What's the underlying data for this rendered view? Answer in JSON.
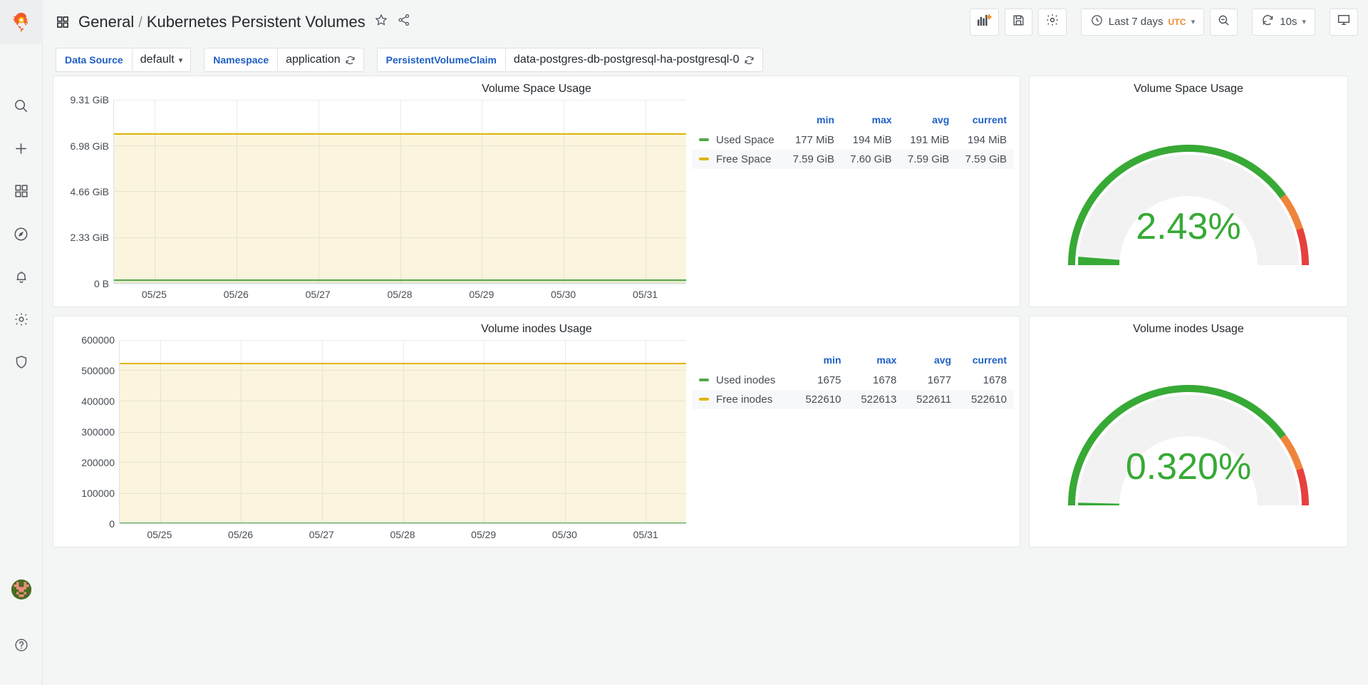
{
  "brand": {
    "logo_icon": "grafana-logo-icon"
  },
  "sidebar": {
    "items": [
      {
        "name": "search",
        "icon": "search-icon"
      },
      {
        "name": "create",
        "icon": "plus-icon"
      },
      {
        "name": "dashboards",
        "icon": "dashboards-grid-icon"
      },
      {
        "name": "explore",
        "icon": "compass-icon"
      },
      {
        "name": "alerting",
        "icon": "bell-icon"
      },
      {
        "name": "configuration",
        "icon": "gear-icon"
      },
      {
        "name": "server-admin",
        "icon": "shield-icon"
      }
    ],
    "bottom": [
      {
        "name": "user-profile",
        "icon": "avatar"
      },
      {
        "name": "help",
        "icon": "question-circle-icon"
      }
    ]
  },
  "topnav": {
    "folder": "General",
    "separator": "/",
    "dashboard_title": "Kubernetes Persistent Volumes",
    "star_icon": "star-icon",
    "share_icon": "share-nodes-icon",
    "dashboard_icon": "dashboard-grid-icon",
    "actions": {
      "add_panel_icon": "add-panel-icon",
      "save_icon": "save-disk-icon",
      "settings_icon": "gear-icon",
      "time_range": "Last 7 days",
      "time_zone": "UTC",
      "time_picker_icon": "clock-icon",
      "zoom_out_icon": "zoom-out-icon",
      "refresh_icon": "refresh-icon",
      "refresh_interval": "10s",
      "tv_icon": "tv-monitor-icon",
      "caret_icon": "chevron-down-icon"
    }
  },
  "variables": [
    {
      "label": "Data Source",
      "value": "default",
      "control": "dropdown",
      "trailing_icon": "chevron-down-icon"
    },
    {
      "label": "Namespace",
      "value": "application",
      "control": "select",
      "trailing_icon": "loading-spinner-icon"
    },
    {
      "label": "PersistentVolumeClaim",
      "value": "data-postgres-db-postgresql-ha-postgresql-0",
      "control": "select",
      "trailing_icon": "loading-spinner-icon"
    }
  ],
  "colors": {
    "green": "#56a64b",
    "yellow": "#e0b400",
    "gauge_green": "#37a935",
    "gauge_orange": "#ef843c",
    "gauge_red": "#e5413f",
    "gauge_track": "#f2f2f2",
    "link_blue": "#1f60c4",
    "accent_orange": "#ed8b2b"
  },
  "panels": [
    {
      "id": "volume-space-usage-graph",
      "title": "Volume Space Usage",
      "type": "graph"
    },
    {
      "id": "volume-space-usage-gauge",
      "title": "Volume Space Usage",
      "type": "gauge",
      "value": "2.43%",
      "value_pct": 2.43,
      "thresholds": [
        {
          "color": "#37a935",
          "from": 0
        },
        {
          "color": "#ef843c",
          "from": 80
        },
        {
          "color": "#e5413f",
          "from": 90
        }
      ]
    },
    {
      "id": "volume-inodes-usage-graph",
      "title": "Volume inodes Usage",
      "type": "graph"
    },
    {
      "id": "volume-inodes-usage-gauge",
      "title": "Volume inodes Usage",
      "type": "gauge",
      "value": "0.320%",
      "value_pct": 0.32,
      "thresholds": [
        {
          "color": "#37a935",
          "from": 0
        },
        {
          "color": "#ef843c",
          "from": 80
        },
        {
          "color": "#e5413f",
          "from": 90
        }
      ]
    }
  ],
  "chart_data": [
    {
      "type": "area",
      "title": "Volume Space Usage",
      "xlabel": "",
      "ylabel": "",
      "grid": true,
      "legend_position": "right-table",
      "x": [
        "05/25",
        "05/26",
        "05/27",
        "05/28",
        "05/29",
        "05/30",
        "05/31"
      ],
      "ytick_labels": [
        "0 B",
        "2.33 GiB",
        "4.66 GiB",
        "6.98 GiB",
        "9.31 GiB"
      ],
      "ytick_values": [
        0,
        2.33,
        4.66,
        6.98,
        9.31
      ],
      "ylim": [
        0,
        9.31
      ],
      "yunit": "GiB",
      "series": [
        {
          "name": "Used Space",
          "color": "#56a64b",
          "values": [
            0.173,
            0.177,
            0.182,
            0.186,
            0.189,
            0.19,
            0.189
          ],
          "stats": {
            "min": "177 MiB",
            "max": "194 MiB",
            "avg": "191 MiB",
            "current": "194 MiB"
          }
        },
        {
          "name": "Free Space",
          "color": "#e0b400",
          "values": [
            7.6,
            7.6,
            7.59,
            7.59,
            7.59,
            7.59,
            7.59
          ],
          "stats": {
            "min": "7.59 GiB",
            "max": "7.60 GiB",
            "avg": "7.59 GiB",
            "current": "7.59 GiB"
          }
        }
      ],
      "legend_columns": [
        "",
        "min",
        "max",
        "avg",
        "current"
      ]
    },
    {
      "type": "area",
      "title": "Volume inodes Usage",
      "xlabel": "",
      "ylabel": "",
      "grid": true,
      "legend_position": "right-table",
      "x": [
        "05/25",
        "05/26",
        "05/27",
        "05/28",
        "05/29",
        "05/30",
        "05/31"
      ],
      "ytick_labels": [
        "0",
        "100000",
        "200000",
        "300000",
        "400000",
        "500000",
        "600000"
      ],
      "ytick_values": [
        0,
        100000,
        200000,
        300000,
        400000,
        500000,
        600000
      ],
      "ylim": [
        0,
        600000
      ],
      "yunit": "",
      "series": [
        {
          "name": "Used inodes",
          "color": "#56a64b",
          "values": [
            1675,
            1676,
            1677,
            1677,
            1678,
            1678,
            1678
          ],
          "stats": {
            "min": "1675",
            "max": "1678",
            "avg": "1677",
            "current": "1678"
          }
        },
        {
          "name": "Free inodes",
          "color": "#e0b400",
          "values": [
            522613,
            522612,
            522611,
            522611,
            522610,
            522610,
            522610
          ],
          "stats": {
            "min": "522610",
            "max": "522613",
            "avg": "522611",
            "current": "522610"
          }
        }
      ],
      "legend_columns": [
        "",
        "min",
        "max",
        "avg",
        "current"
      ]
    },
    {
      "type": "gauge",
      "title": "Volume Space Usage",
      "value": 2.43,
      "value_label": "2.43%",
      "min": 0,
      "max": 100,
      "unit": "percent",
      "thresholds": [
        {
          "value": 0,
          "color": "#37a935"
        },
        {
          "value": 80,
          "color": "#ef843c"
        },
        {
          "value": 90,
          "color": "#e5413f"
        }
      ]
    },
    {
      "type": "gauge",
      "title": "Volume inodes Usage",
      "value": 0.32,
      "value_label": "0.320%",
      "min": 0,
      "max": 100,
      "unit": "percent",
      "thresholds": [
        {
          "value": 0,
          "color": "#37a935"
        },
        {
          "value": 80,
          "color": "#ef843c"
        },
        {
          "value": 90,
          "color": "#e5413f"
        }
      ]
    }
  ]
}
